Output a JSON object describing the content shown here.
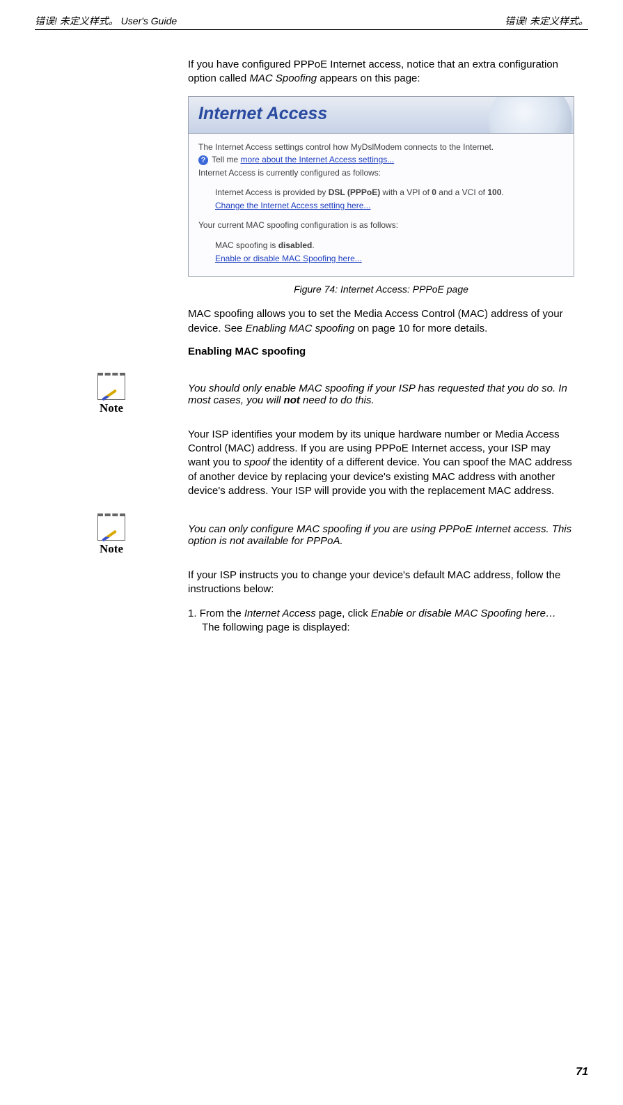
{
  "header": {
    "left_prefix": "错误! 未定义样式。",
    "left_suffix": " User's Guide",
    "right": "错误! 未定义样式。"
  },
  "intro": {
    "p1_a": "If you have configured PPPoE Internet access, notice that an extra configuration option called ",
    "p1_b": "MAC Spoofing",
    "p1_c": " appears on this page:"
  },
  "screenshot": {
    "title": "Internet Access",
    "line1": "The Internet Access settings control how MyDslModem connects to the Internet.",
    "help_text": "Tell me ",
    "help_link": "more about the Internet Access settings...",
    "line2": "Internet Access is currently configured as follows:",
    "prov_a": "Internet Access is provided by ",
    "prov_b": "DSL (PPPoE)",
    "prov_c": " with a VPI of ",
    "prov_d": "0",
    "prov_e": " and a VCI of ",
    "prov_f": "100",
    "prov_g": ".",
    "change_link": "Change the Internet Access setting here...",
    "mac_intro": "Your current MAC spoofing configuration is as follows:",
    "mac_a": "MAC spoofing is ",
    "mac_b": "disabled",
    "mac_c": ".",
    "mac_link": "Enable or disable MAC Spoofing here..."
  },
  "figure": {
    "caption": "Figure 74:      Internet Access: PPPoE page"
  },
  "after_fig": {
    "p_a": "MAC spoofing allows you to set the Media Access Control (MAC) address of your device. See ",
    "p_b": "Enabling MAC spoofing",
    "p_c": " on page 10 for more details."
  },
  "section_head": "Enabling MAC spoofing",
  "note1": {
    "label": "Note",
    "text_a": "You should only enable MAC spoofing if your ISP has requested that you do so. In most cases, you will ",
    "text_b": "not",
    "text_c": " need to do this."
  },
  "body_para": {
    "a": "Your ISP identifies your modem by its unique hardware number or Media Access Control (MAC) address. If you are using PPPoE Internet access, your ISP may want you to ",
    "b": "spoof",
    "c": " the identity of a different device. You can spoof the MAC address of another device by replacing your device's existing MAC address with another device's address. Your ISP will provide you with the replacement MAC address."
  },
  "note2": {
    "label": "Note",
    "text": "You can only configure MAC spoofing if you are using PPPoE Internet access. This option is not available for PPPoA."
  },
  "instructions": {
    "intro": "If your ISP instructs you to change your device's default MAC address, follow the instructions below:",
    "item1_num": "1.   ",
    "item1_a": "From the ",
    "item1_b": "Internet Access",
    "item1_c": " page, click ",
    "item1_d": "Enable or disable MAC Spoofing here…",
    "item1_e": " The following page is displayed:"
  },
  "page_number": "71"
}
